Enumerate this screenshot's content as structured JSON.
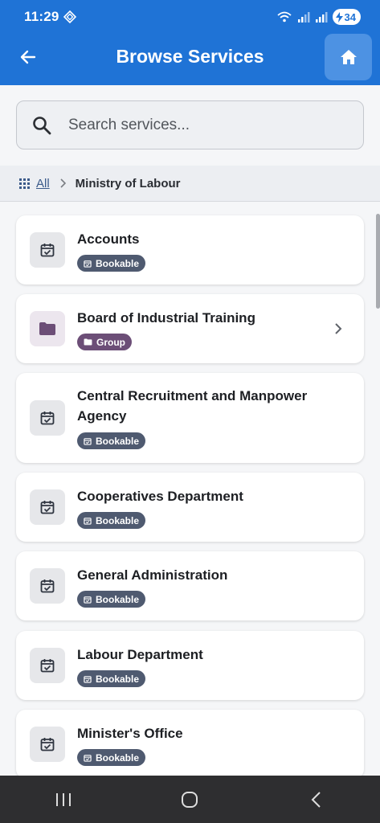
{
  "status": {
    "time": "11:29",
    "battery": "34"
  },
  "header": {
    "title": "Browse Services",
    "back_icon": "arrow-left-icon",
    "home_icon": "home-icon"
  },
  "search": {
    "placeholder": "Search services...",
    "value": ""
  },
  "breadcrumb": {
    "root": "All",
    "current": "Ministry of Labour"
  },
  "items": [
    {
      "name": "Accounts",
      "badge": "Bookable",
      "type": "bookable"
    },
    {
      "name": "Board of Industrial Training",
      "badge": "Group",
      "type": "group"
    },
    {
      "name": "Central Recruitment and Manpower Agency",
      "badge": "Bookable",
      "type": "bookable"
    },
    {
      "name": "Cooperatives Department",
      "badge": "Bookable",
      "type": "bookable"
    },
    {
      "name": "General Administration",
      "badge": "Bookable",
      "type": "bookable"
    },
    {
      "name": "Labour Department",
      "badge": "Bookable",
      "type": "bookable"
    },
    {
      "name": "Minister's Office",
      "badge": "Bookable",
      "type": "bookable"
    }
  ],
  "colors": {
    "primary": "#1f73d6",
    "bookable_badge": "#4f5a70",
    "group_badge": "#6c4e77"
  }
}
